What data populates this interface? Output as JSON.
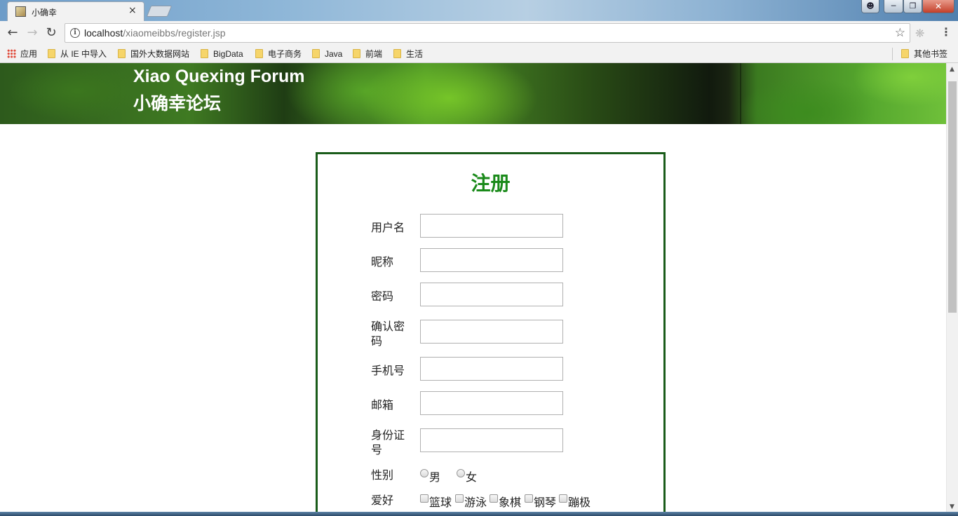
{
  "browser": {
    "tab_title": "小确幸",
    "tab_close": "×",
    "url_host": "localhost",
    "url_path": "/xiaomeibbs/register.jsp",
    "bookmarks": [
      "应用",
      "从 IE 中导入",
      "国外大数据网站",
      "BigData",
      "电子商务",
      "Java",
      "前端",
      "生活"
    ],
    "other_bookmarks": "其他书签"
  },
  "site": {
    "title_en": "Xiao Quexing Forum",
    "title_cn": "小确幸论坛"
  },
  "form": {
    "heading": "注册",
    "fields": [
      {
        "label": "用户名",
        "value": ""
      },
      {
        "label": "昵称",
        "value": ""
      },
      {
        "label": "密码",
        "value": ""
      },
      {
        "label": "确认密码",
        "value": ""
      },
      {
        "label": "手机号",
        "value": ""
      },
      {
        "label": "邮箱",
        "value": ""
      },
      {
        "label": "身份证号",
        "value": ""
      }
    ],
    "gender": {
      "label": "性别",
      "options": [
        "男",
        "女"
      ]
    },
    "hobbies": {
      "label": "爱好",
      "options": [
        "篮球",
        "游泳",
        "象棋",
        "钢琴",
        "蹦极"
      ]
    }
  },
  "colors": {
    "accent_green": "#1a8a1a",
    "box_border": "#1a5c1a"
  }
}
